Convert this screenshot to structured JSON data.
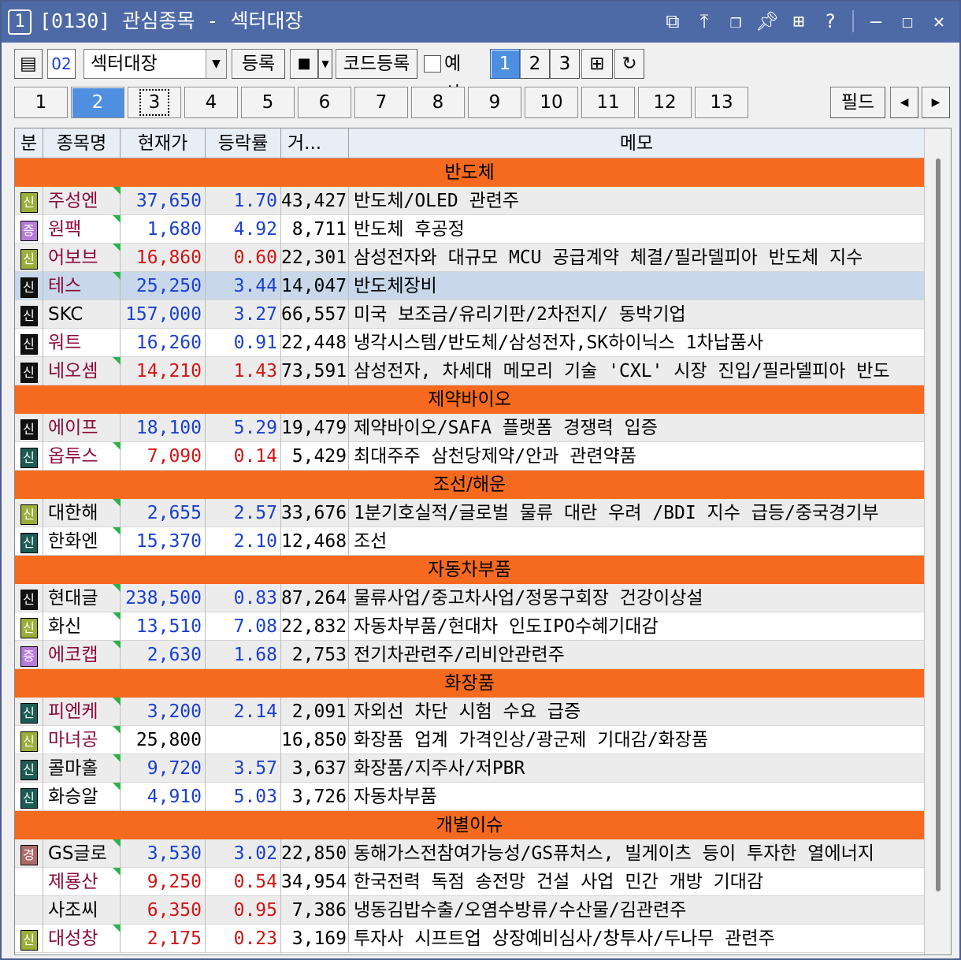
{
  "window": {
    "number": "1",
    "title": "[0130] 관심종목 - 섹터대장",
    "icons": [
      "link-icon",
      "pin-top-icon",
      "restore-windows-icon",
      "push-pin-icon",
      "grid-icon",
      "help-icon",
      "minimize-icon",
      "maximize-icon",
      "close-icon"
    ]
  },
  "toolbar": {
    "group_code": "02",
    "group_name": "섹터대장",
    "register_label": "등록",
    "stop_label": "■",
    "code_register_label": "코드등록",
    "forecast_label": "예상",
    "view_buttons": [
      "1",
      "2",
      "3"
    ],
    "active_view": "1"
  },
  "tabs": {
    "items": [
      "1",
      "2",
      "3",
      "4",
      "5",
      "6",
      "7",
      "8",
      "9",
      "10",
      "11",
      "12",
      "13"
    ],
    "active": "2",
    "focused": "3",
    "field_label": "필드",
    "prev": "◀",
    "next": "▶"
  },
  "table": {
    "headers": [
      "분",
      "종목명",
      "현재가",
      "등락률",
      "거...",
      "메모"
    ],
    "rows": [
      {
        "type": "sector",
        "label": "반도체"
      },
      {
        "type": "stock",
        "badge": "신",
        "badge_color": "#9aae3a",
        "name": "주성엔",
        "name_color": "#8b0a3a",
        "flag": true,
        "price": "37,650",
        "rate": "1.70",
        "vol": "43,427",
        "dir": "down",
        "memo": "반도체/OLED 관련주"
      },
      {
        "type": "stock",
        "badge": "증",
        "badge_color": "#b77bd8",
        "name": "원팩",
        "name_color": "#8b0a3a",
        "flag": true,
        "price": "1,680",
        "rate": "4.92",
        "vol": "8,711",
        "dir": "down",
        "memo": "반도체 후공정"
      },
      {
        "type": "stock",
        "badge": "신",
        "badge_color": "#9aae3a",
        "name": "어보브",
        "name_color": "#8b0a3a",
        "flag": true,
        "price": "16,860",
        "rate": "0.60",
        "vol": "22,301",
        "dir": "up",
        "memo": "삼성전자와 대규모 MCU 공급계약 체결/필라델피아 반도체 지수"
      },
      {
        "type": "stock",
        "badge": "신",
        "badge_color": "#111111",
        "name": "테스",
        "name_color": "#8b0a3a",
        "flag": true,
        "price": "25,250",
        "rate": "3.44",
        "vol": "14,047",
        "dir": "down",
        "memo": "반도체장비",
        "selected": true
      },
      {
        "type": "stock",
        "badge": "신",
        "badge_color": "#111111",
        "name": "SKC",
        "name_color": "#000000",
        "flag": false,
        "price": "157,000",
        "rate": "3.27",
        "vol": "66,557",
        "dir": "down",
        "memo": "미국 보조금/유리기판/2차전지/ 동박기업"
      },
      {
        "type": "stock",
        "badge": "신",
        "badge_color": "#111111",
        "name": "워트",
        "name_color": "#8b0a3a",
        "flag": false,
        "price": "16,260",
        "rate": "0.91",
        "vol": "22,448",
        "dir": "down",
        "memo": "냉각시스템/반도체/삼성전자,SK하이닉스 1차납품사"
      },
      {
        "type": "stock",
        "badge": "신",
        "badge_color": "#111111",
        "name": "네오셈",
        "name_color": "#8b0a3a",
        "flag": true,
        "price": "14,210",
        "rate": "1.43",
        "vol": "73,591",
        "dir": "up",
        "memo": "삼성전자, 차세대 메모리 기술 'CXL' 시장 진입/필라델피아 반도"
      },
      {
        "type": "sector",
        "label": "제약바이오"
      },
      {
        "type": "stock",
        "badge": "신",
        "badge_color": "#111111",
        "name": "에이프",
        "name_color": "#8b0a3a",
        "flag": false,
        "price": "18,100",
        "rate": "5.29",
        "vol": "19,479",
        "dir": "down",
        "memo": "제약바이오/SAFA 플랫폼 경쟁력 입증"
      },
      {
        "type": "stock",
        "badge": "신",
        "badge_color": "#1d5c56",
        "name": "옵투스",
        "name_color": "#8b0a3a",
        "flag": true,
        "price": "7,090",
        "rate": "0.14",
        "vol": "5,429",
        "dir": "up",
        "memo": "최대주주 삼천당제약/안과 관련약품"
      },
      {
        "type": "sector",
        "label": "조선/해운"
      },
      {
        "type": "stock",
        "badge": "신",
        "badge_color": "#9aae3a",
        "name": "대한해",
        "name_color": "#000000",
        "flag": true,
        "price": "2,655",
        "rate": "2.57",
        "vol": "33,676",
        "dir": "down",
        "memo": "1분기호실적/글로벌 물류 대란 우려 /BDI 지수 급등/중국경기부"
      },
      {
        "type": "stock",
        "badge": "신",
        "badge_color": "#1d5c56",
        "name": "한화엔",
        "name_color": "#000000",
        "flag": true,
        "price": "15,370",
        "rate": "2.10",
        "vol": "12,468",
        "dir": "down",
        "memo": "조선"
      },
      {
        "type": "sector",
        "label": "자동차부품"
      },
      {
        "type": "stock",
        "badge": "신",
        "badge_color": "#111111",
        "name": "현대글",
        "name_color": "#000000",
        "flag": true,
        "price": "238,500",
        "rate": "0.83",
        "vol": "87,264",
        "dir": "down",
        "memo": "물류사업/중고차사업/정몽구회장 건강이상설"
      },
      {
        "type": "stock",
        "badge": "신",
        "badge_color": "#9aae3a",
        "name": "화신",
        "name_color": "#000000",
        "flag": true,
        "price": "13,510",
        "rate": "7.08",
        "vol": "22,832",
        "dir": "down",
        "memo": "자동차부품/현대차 인도IPO수혜기대감"
      },
      {
        "type": "stock",
        "badge": "증",
        "badge_color": "#b77bd8",
        "name": "에코캡",
        "name_color": "#8b0a3a",
        "flag": true,
        "price": "2,630",
        "rate": "1.68",
        "vol": "2,753",
        "dir": "down",
        "memo": "전기차관련주/리비안관련주"
      },
      {
        "type": "sector",
        "label": "화장품"
      },
      {
        "type": "stock",
        "badge": "신",
        "badge_color": "#1d5c56",
        "name": "피엔케",
        "name_color": "#8b0a3a",
        "flag": true,
        "price": "3,200",
        "rate": "2.14",
        "vol": "2,091",
        "dir": "down",
        "memo": "자외선 차단 시험 수요 급증"
      },
      {
        "type": "stock",
        "badge": "신",
        "badge_color": "#9aae3a",
        "name": "마녀공",
        "name_color": "#8b0a3a",
        "flag": true,
        "price": "25,800",
        "rate": "",
        "vol": "16,850",
        "dir": "flat",
        "memo": "화장품 업계 가격인상/광군제 기대감/화장품"
      },
      {
        "type": "stock",
        "badge": "신",
        "badge_color": "#1d5c56",
        "name": "콜마홀",
        "name_color": "#000000",
        "flag": true,
        "price": "9,720",
        "rate": "3.57",
        "vol": "3,637",
        "dir": "down",
        "memo": "화장품/지주사/저PBR"
      },
      {
        "type": "stock",
        "badge": "신",
        "badge_color": "#1d5c56",
        "name": "화승알",
        "name_color": "#000000",
        "flag": true,
        "price": "4,910",
        "rate": "5.03",
        "vol": "3,726",
        "dir": "down",
        "memo": "자동차부품"
      },
      {
        "type": "sector",
        "label": "개별이슈"
      },
      {
        "type": "stock",
        "badge": "경",
        "badge_color": "#b06a6a",
        "name": "GS글로",
        "name_color": "#000000",
        "flag": true,
        "price": "3,530",
        "rate": "3.02",
        "vol": "22,850",
        "dir": "down",
        "memo": "동해가스전참여가능성/GS퓨처스, 빌게이츠 등이 투자한 열에너지"
      },
      {
        "type": "stock",
        "badge": "",
        "badge_color": "",
        "name": "제룡산",
        "name_color": "#8b0a3a",
        "flag": true,
        "price": "9,250",
        "rate": "0.54",
        "vol": "34,954",
        "dir": "up",
        "memo": "한국전력 독점 송전망 건설 사업 민간 개방 기대감"
      },
      {
        "type": "stock",
        "badge": "",
        "badge_color": "",
        "name": "사조씨",
        "name_color": "#000000",
        "flag": false,
        "price": "6,350",
        "rate": "0.95",
        "vol": "7,386",
        "dir": "up",
        "memo": "냉동김밥수출/오염수방류/수산물/김관련주"
      },
      {
        "type": "stock",
        "badge": "신",
        "badge_color": "#9aae3a",
        "name": "대성창",
        "name_color": "#8b0a3a",
        "flag": true,
        "price": "2,175",
        "rate": "0.23",
        "vol": "3,169",
        "dir": "up",
        "memo": "투자사 시프트업 상장예비심사/창투사/두나무 관련주"
      }
    ]
  },
  "colors": {
    "title_bar": "#4e6aa6",
    "sector_bg": "#f56a1f",
    "up": "#d01515",
    "down": "#1a3fd0",
    "selected_row": "#c8d8ea"
  }
}
